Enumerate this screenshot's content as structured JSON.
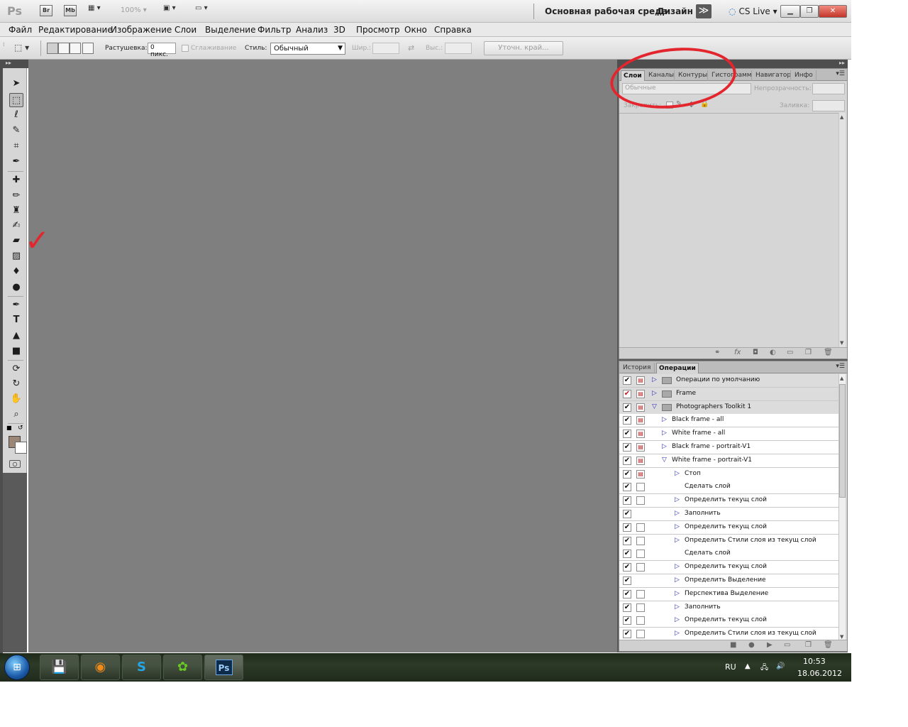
{
  "titlebar": {
    "logo": "Ps",
    "br_label": "Br",
    "mb_label": "Mb",
    "zoom": "100%",
    "workspace": "Основная рабочая среда",
    "design": "Дизайн",
    "more": "≫",
    "cslive": "CS Live"
  },
  "menu": [
    "Файл",
    "Редактирование",
    "Изображение",
    "Слои",
    "Выделение",
    "Фильтр",
    "Анализ",
    "3D",
    "Просмотр",
    "Окно",
    "Справка"
  ],
  "options": {
    "feather_label": "Растушевка:",
    "feather_value": "0 пикс.",
    "antialias_label": "Сглаживание",
    "style_label": "Стиль:",
    "style_value": "Обычный",
    "width_label": "Шир.:",
    "height_label": "Выс.:",
    "refine_label": "Уточн. край..."
  },
  "tools": [
    {
      "name": "move-tool",
      "glyph": "➤"
    },
    {
      "name": "marquee-tool",
      "glyph": "⬚"
    },
    {
      "name": "lasso-tool",
      "glyph": "ℓ"
    },
    {
      "name": "quick-selection-tool",
      "glyph": "✎"
    },
    {
      "name": "crop-tool",
      "glyph": "⌗"
    },
    {
      "name": "eyedropper-tool",
      "glyph": "✒"
    },
    {
      "name": "healing-brush-tool",
      "glyph": "✚"
    },
    {
      "name": "brush-tool",
      "glyph": "✏"
    },
    {
      "name": "clone-stamp-tool",
      "glyph": "♜"
    },
    {
      "name": "history-brush-tool",
      "glyph": "✍"
    },
    {
      "name": "eraser-tool",
      "glyph": "▰"
    },
    {
      "name": "gradient-tool",
      "glyph": "▨"
    },
    {
      "name": "blur-tool",
      "glyph": "💧"
    },
    {
      "name": "dodge-tool",
      "glyph": "●"
    },
    {
      "name": "pen-tool",
      "glyph": "✒"
    },
    {
      "name": "type-tool",
      "glyph": "T"
    },
    {
      "name": "path-selection-tool",
      "glyph": "▲"
    },
    {
      "name": "rectangle-tool",
      "glyph": "■"
    },
    {
      "name": "3d-rotate-tool",
      "glyph": "⟳"
    },
    {
      "name": "3d-orbit-tool",
      "glyph": "↻"
    },
    {
      "name": "hand-tool",
      "glyph": "✋"
    },
    {
      "name": "zoom-tool",
      "glyph": "🔍"
    }
  ],
  "layers_panel": {
    "tabs": [
      "Слои",
      "Каналы",
      "Контуры",
      "Гистограмма",
      "Навигатор",
      "Инфо"
    ],
    "blend_mode": "Обычные",
    "opacity_label": "Непрозрачность:",
    "lock_label": "Закрепить:",
    "fill_label": "Заливка:"
  },
  "actions_panel": {
    "tabs": [
      "История",
      "Операции"
    ],
    "rows": [
      {
        "label": "Операции по умолчанию",
        "type": "folder",
        "check": "✔",
        "check_red": false,
        "dialog": "▤",
        "expanded": false,
        "indent": 0
      },
      {
        "label": "Frame",
        "type": "folder",
        "check": "✔",
        "check_red": true,
        "dialog": "▤",
        "expanded": false,
        "indent": 0
      },
      {
        "label": "Photographers Toolkit 1",
        "type": "folder",
        "check": "✔",
        "check_red": false,
        "dialog": "▤",
        "expanded": true,
        "indent": 0
      },
      {
        "label": "Black frame - all",
        "type": "action",
        "check": "✔",
        "check_red": false,
        "dialog": "▤",
        "expanded": false,
        "indent": 1
      },
      {
        "label": "White frame - all",
        "type": "action",
        "check": "✔",
        "check_red": false,
        "dialog": "▤",
        "expanded": false,
        "indent": 1
      },
      {
        "label": "Black frame - portrait-V1",
        "type": "action",
        "check": "✔",
        "check_red": false,
        "dialog": "▤",
        "expanded": false,
        "indent": 1
      },
      {
        "label": "White frame - portrait-V1",
        "type": "action",
        "check": "✔",
        "check_red": false,
        "dialog": "▤",
        "expanded": true,
        "indent": 1
      },
      {
        "label": "Стоп",
        "type": "step",
        "check": "✔",
        "check_red": false,
        "dialog": "▤",
        "expanded": false,
        "indent": 2
      },
      {
        "label": "Сделать слой",
        "type": "step-leaf",
        "check": "✔",
        "check_red": false,
        "dialog": "",
        "expanded": false,
        "indent": 2
      },
      {
        "label": "Определить текущ слой",
        "type": "step",
        "check": "✔",
        "check_red": false,
        "dialog": "",
        "expanded": false,
        "indent": 2
      },
      {
        "label": "Заполнить",
        "type": "step",
        "check": "✔",
        "check_red": false,
        "dialog": "none",
        "expanded": false,
        "indent": 2
      },
      {
        "label": "Определить текущ слой",
        "type": "step",
        "check": "✔",
        "check_red": false,
        "dialog": "",
        "expanded": false,
        "indent": 2
      },
      {
        "label": "Определить Стили слоя из текущ слой",
        "type": "step",
        "check": "✔",
        "check_red": false,
        "dialog": "",
        "expanded": false,
        "indent": 2
      },
      {
        "label": "Сделать слой",
        "type": "step-leaf",
        "check": "✔",
        "check_red": false,
        "dialog": "",
        "expanded": false,
        "indent": 2
      },
      {
        "label": "Определить текущ слой",
        "type": "step",
        "check": "✔",
        "check_red": false,
        "dialog": "",
        "expanded": false,
        "indent": 2
      },
      {
        "label": "Определить Выделение",
        "type": "step",
        "check": "✔",
        "check_red": false,
        "dialog": "none",
        "expanded": false,
        "indent": 2
      },
      {
        "label": "Перспектива Выделение",
        "type": "step",
        "check": "✔",
        "check_red": false,
        "dialog": "",
        "expanded": false,
        "indent": 2
      },
      {
        "label": "Заполнить",
        "type": "step",
        "check": "✔",
        "check_red": false,
        "dialog": "",
        "expanded": false,
        "indent": 2
      },
      {
        "label": "Определить текущ слой",
        "type": "step",
        "check": "✔",
        "check_red": false,
        "dialog": "",
        "expanded": false,
        "indent": 2
      },
      {
        "label": "Определить Стили слоя из текущ слой",
        "type": "step",
        "check": "✔",
        "check_red": false,
        "dialog": "",
        "expanded": false,
        "indent": 2
      }
    ]
  },
  "taskbar": {
    "lang": "RU",
    "time": "10:53",
    "date": "18.06.2012",
    "apps": [
      "save-disk-app",
      "firefox-app",
      "skype-app",
      "icq-app",
      "photoshop-app"
    ]
  },
  "colors": {
    "foreground": "#9c8676",
    "background": "#ffffff",
    "annotation": "#e3262e"
  }
}
